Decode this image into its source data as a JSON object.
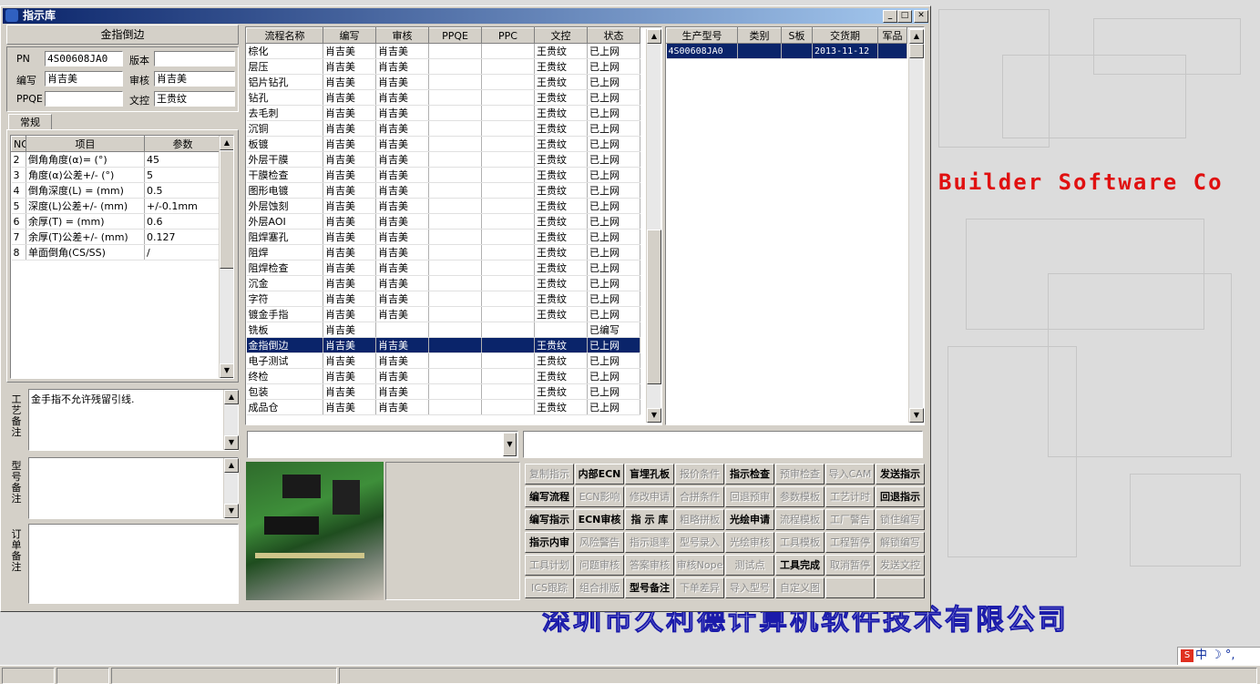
{
  "window": {
    "title": "指示库"
  },
  "header": {
    "process_name": "金指倒边",
    "fields": [
      {
        "label": "PN",
        "value": "4S00608JA0"
      },
      {
        "label": "版本",
        "value": ""
      },
      {
        "label": "编写",
        "value": "肖吉美"
      },
      {
        "label": "审核",
        "value": "肖吉美"
      },
      {
        "label": "PPQE",
        "value": ""
      },
      {
        "label": "文控",
        "value": "王贵纹"
      }
    ]
  },
  "tabs": {
    "general": "常规"
  },
  "params": {
    "headers": [
      "NO",
      "项目",
      "参数"
    ],
    "rows": [
      {
        "no": "2",
        "item": "倒角角度(α)=  (°)",
        "value": "45"
      },
      {
        "no": "3",
        "item": "角度(α)公差+/-  (°)",
        "value": "5"
      },
      {
        "no": "4",
        "item": "倒角深度(L) =  (mm)",
        "value": "0.5"
      },
      {
        "no": "5",
        "item": "深度(L)公差+/-  (mm)",
        "value": "+/-0.1mm"
      },
      {
        "no": "6",
        "item": "余厚(T) =  (mm)",
        "value": "0.6"
      },
      {
        "no": "7",
        "item": "余厚(T)公差+/-  (mm)",
        "value": "0.127"
      },
      {
        "no": "8",
        "item": "单面倒角(CS/SS)",
        "value": "/"
      }
    ]
  },
  "notes": {
    "craft_label": "工艺备注",
    "craft_text": "金手指不允许残留引线.",
    "model_label": "型号备注",
    "model_text": "",
    "order_label": "订单备注",
    "order_text": ""
  },
  "flow": {
    "headers": [
      "流程名称",
      "编写",
      "审核",
      "PPQE",
      "PPC",
      "文控",
      "状态"
    ],
    "rows": [
      [
        "棕化",
        "肖吉美",
        "肖吉美",
        "",
        "",
        "王贵纹",
        "已上网"
      ],
      [
        "层压",
        "肖吉美",
        "肖吉美",
        "",
        "",
        "王贵纹",
        "已上网"
      ],
      [
        "铝片钻孔",
        "肖吉美",
        "肖吉美",
        "",
        "",
        "王贵纹",
        "已上网"
      ],
      [
        "钻孔",
        "肖吉美",
        "肖吉美",
        "",
        "",
        "王贵纹",
        "已上网"
      ],
      [
        "去毛刺",
        "肖吉美",
        "肖吉美",
        "",
        "",
        "王贵纹",
        "已上网"
      ],
      [
        "沉铜",
        "肖吉美",
        "肖吉美",
        "",
        "",
        "王贵纹",
        "已上网"
      ],
      [
        "板镀",
        "肖吉美",
        "肖吉美",
        "",
        "",
        "王贵纹",
        "已上网"
      ],
      [
        "外层干膜",
        "肖吉美",
        "肖吉美",
        "",
        "",
        "王贵纹",
        "已上网"
      ],
      [
        "干膜检查",
        "肖吉美",
        "肖吉美",
        "",
        "",
        "王贵纹",
        "已上网"
      ],
      [
        "图形电镀",
        "肖吉美",
        "肖吉美",
        "",
        "",
        "王贵纹",
        "已上网"
      ],
      [
        "外层蚀刻",
        "肖吉美",
        "肖吉美",
        "",
        "",
        "王贵纹",
        "已上网"
      ],
      [
        "外层AOI",
        "肖吉美",
        "肖吉美",
        "",
        "",
        "王贵纹",
        "已上网"
      ],
      [
        "阻焊塞孔",
        "肖吉美",
        "肖吉美",
        "",
        "",
        "王贵纹",
        "已上网"
      ],
      [
        "阻焊",
        "肖吉美",
        "肖吉美",
        "",
        "",
        "王贵纹",
        "已上网"
      ],
      [
        "阻焊检查",
        "肖吉美",
        "肖吉美",
        "",
        "",
        "王贵纹",
        "已上网"
      ],
      [
        "沉金",
        "肖吉美",
        "肖吉美",
        "",
        "",
        "王贵纹",
        "已上网"
      ],
      [
        "字符",
        "肖吉美",
        "肖吉美",
        "",
        "",
        "王贵纹",
        "已上网"
      ],
      [
        "镀金手指",
        "肖吉美",
        "肖吉美",
        "",
        "",
        "王贵纹",
        "已上网"
      ],
      [
        "铣板",
        "肖吉美",
        "",
        "",
        "",
        "",
        "已编写"
      ],
      [
        "金指倒边",
        "肖吉美",
        "肖吉美",
        "",
        "",
        "王贵纹",
        "已上网"
      ],
      [
        "电子测试",
        "肖吉美",
        "肖吉美",
        "",
        "",
        "王贵纹",
        "已上网"
      ],
      [
        "终检",
        "肖吉美",
        "肖吉美",
        "",
        "",
        "王贵纹",
        "已上网"
      ],
      [
        "包装",
        "肖吉美",
        "肖吉美",
        "",
        "",
        "王贵纹",
        "已上网"
      ],
      [
        "成品仓",
        "肖吉美",
        "肖吉美",
        "",
        "",
        "王贵纹",
        "已上网"
      ]
    ],
    "selected_index": 19
  },
  "models": {
    "headers": [
      "生产型号",
      "类别",
      "S板",
      "交货期",
      "军品"
    ],
    "rows": [
      [
        "4S00608JA0",
        "",
        "",
        "2013-11-12",
        ""
      ]
    ]
  },
  "combo": {
    "value": ""
  },
  "text_input": {
    "value": ""
  },
  "actions": [
    [
      {
        "t": "复制指示",
        "e": false
      },
      {
        "t": "内部ECN",
        "e": true
      },
      {
        "t": "盲埋孔板",
        "e": true
      },
      {
        "t": "报价条件",
        "e": false
      },
      {
        "t": "指示检查",
        "e": true
      },
      {
        "t": "预审检查",
        "e": false
      },
      {
        "t": "导入CAM",
        "e": false
      },
      {
        "t": "发送指示",
        "e": true
      }
    ],
    [
      {
        "t": "编写流程",
        "e": true
      },
      {
        "t": "ECN影响",
        "e": false
      },
      {
        "t": "修改申请",
        "e": false
      },
      {
        "t": "合拼条件",
        "e": false
      },
      {
        "t": "回退预审",
        "e": false
      },
      {
        "t": "参数模板",
        "e": false
      },
      {
        "t": "工艺计时",
        "e": false
      },
      {
        "t": "回退指示",
        "e": true
      }
    ],
    [
      {
        "t": "编写指示",
        "e": true
      },
      {
        "t": "ECN审核",
        "e": true
      },
      {
        "t": "指 示 库",
        "e": true
      },
      {
        "t": "粗略拼板",
        "e": false
      },
      {
        "t": "光绘申请",
        "e": true
      },
      {
        "t": "流程模板",
        "e": false
      },
      {
        "t": "工厂警告",
        "e": false
      },
      {
        "t": "锁住编写",
        "e": false
      }
    ],
    [
      {
        "t": "指示内审",
        "e": true
      },
      {
        "t": "风险警告",
        "e": false
      },
      {
        "t": "指示退率",
        "e": false
      },
      {
        "t": "型号录入",
        "e": false
      },
      {
        "t": "光绘审核",
        "e": false
      },
      {
        "t": "工具模板",
        "e": false
      },
      {
        "t": "工程暂停",
        "e": false
      },
      {
        "t": "解锁编写",
        "e": false
      }
    ],
    [
      {
        "t": "工具计划",
        "e": false
      },
      {
        "t": "问题审核",
        "e": false
      },
      {
        "t": "答案审核",
        "e": false
      },
      {
        "t": "审核Nope",
        "e": false
      },
      {
        "t": "测试点",
        "e": false
      },
      {
        "t": "工具完成",
        "e": true
      },
      {
        "t": "取消暂停",
        "e": false
      },
      {
        "t": "发送文控",
        "e": false
      }
    ],
    [
      {
        "t": "ICS跟踪",
        "e": false
      },
      {
        "t": "组合排版",
        "e": false
      },
      {
        "t": "型号备注",
        "e": true
      },
      {
        "t": "下单差异",
        "e": false
      },
      {
        "t": "导入型号",
        "e": false
      },
      {
        "t": "自定义图",
        "e": false
      },
      {
        "t": "",
        "e": false
      },
      {
        "t": "",
        "e": false
      }
    ]
  ],
  "background": {
    "builder_text": "Builder Software Co",
    "company_text": "深圳市久利德计算机软件技术有限公司"
  },
  "ime": {
    "text": "中"
  },
  "colors": {
    "selection": "#0a246a",
    "title_start": "#0a246a",
    "title_end": "#a6caf0",
    "builder_red": "#e01010",
    "company_blue": "#2a2acc"
  }
}
